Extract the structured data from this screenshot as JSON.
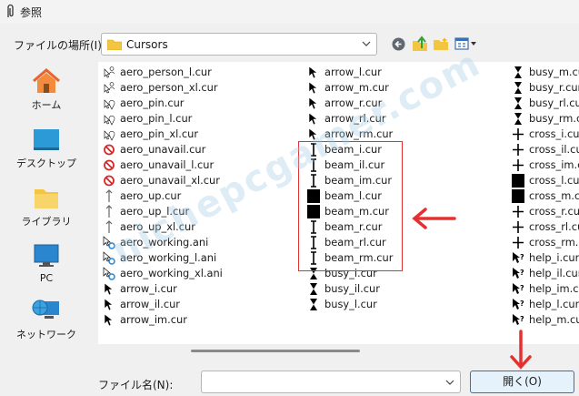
{
  "window": {
    "title": "参照"
  },
  "lookin": {
    "label": "ファイルの場所(I):",
    "value": "Cursors"
  },
  "places": [
    {
      "label": "ホーム",
      "icon": "home-icon"
    },
    {
      "label": "デスクトップ",
      "icon": "desktop-icon"
    },
    {
      "label": "ライブラリ",
      "icon": "library-icon"
    },
    {
      "label": "PC",
      "icon": "pc-icon"
    },
    {
      "label": "ネットワーク",
      "icon": "network-icon"
    }
  ],
  "files": {
    "col1": [
      {
        "name": "aero_person_l.cur",
        "icon": "person-cursor-icon"
      },
      {
        "name": "aero_person_xl.cur",
        "icon": "person-cursor-icon"
      },
      {
        "name": "aero_pin.cur",
        "icon": "pin-cursor-icon"
      },
      {
        "name": "aero_pin_l.cur",
        "icon": "pin-cursor-icon"
      },
      {
        "name": "aero_pin_xl.cur",
        "icon": "pin-cursor-icon"
      },
      {
        "name": "aero_unavail.cur",
        "icon": "unavailable-cursor-icon"
      },
      {
        "name": "aero_unavail_l.cur",
        "icon": "unavailable-cursor-icon"
      },
      {
        "name": "aero_unavail_xl.cur",
        "icon": "unavailable-cursor-icon"
      },
      {
        "name": "aero_up.cur",
        "icon": "up-arrow-cursor-icon"
      },
      {
        "name": "aero_up_l.cur",
        "icon": "up-arrow-cursor-icon"
      },
      {
        "name": "aero_up_xl.cur",
        "icon": "up-arrow-cursor-icon"
      },
      {
        "name": "aero_working.ani",
        "icon": "working-cursor-icon"
      },
      {
        "name": "aero_working_l.ani",
        "icon": "working-cursor-icon"
      },
      {
        "name": "aero_working_xl.ani",
        "icon": "working-cursor-icon"
      },
      {
        "name": "arrow_i.cur",
        "icon": "arrow-cursor-icon"
      },
      {
        "name": "arrow_il.cur",
        "icon": "arrow-cursor-icon"
      },
      {
        "name": "arrow_im.cur",
        "icon": "arrow-cursor-icon"
      }
    ],
    "col2": [
      {
        "name": "arrow_l.cur",
        "icon": "arrow-cursor-icon"
      },
      {
        "name": "arrow_m.cur",
        "icon": "arrow-cursor-icon"
      },
      {
        "name": "arrow_r.cur",
        "icon": "arrow-cursor-icon"
      },
      {
        "name": "arrow_rl.cur",
        "icon": "arrow-cursor-icon"
      },
      {
        "name": "arrow_rm.cur",
        "icon": "arrow-cursor-icon"
      },
      {
        "name": "beam_i.cur",
        "icon": "beam-cursor-icon"
      },
      {
        "name": "beam_il.cur",
        "icon": "beam-cursor-icon"
      },
      {
        "name": "beam_im.cur",
        "icon": "beam-cursor-icon"
      },
      {
        "name": "beam_l.cur",
        "icon": "block-cursor-icon"
      },
      {
        "name": "beam_m.cur",
        "icon": "block-cursor-icon"
      },
      {
        "name": "beam_r.cur",
        "icon": "beam-cursor-icon"
      },
      {
        "name": "beam_rl.cur",
        "icon": "beam-cursor-icon"
      },
      {
        "name": "beam_rm.cur",
        "icon": "beam-cursor-icon"
      },
      {
        "name": "busy_i.cur",
        "icon": "hourglass-cursor-icon"
      },
      {
        "name": "busy_il.cur",
        "icon": "hourglass-cursor-icon"
      },
      {
        "name": "busy_l.cur",
        "icon": "hourglass-cursor-icon"
      }
    ],
    "col3": [
      {
        "name": "busy_m.cur",
        "icon": "hourglass-cursor-icon"
      },
      {
        "name": "busy_r.cur",
        "icon": "hourglass-cursor-icon"
      },
      {
        "name": "busy_rl.cur",
        "icon": "hourglass-cursor-icon"
      },
      {
        "name": "busy_rm.cur",
        "icon": "hourglass-cursor-icon"
      },
      {
        "name": "cross_i.cur",
        "icon": "cross-cursor-icon"
      },
      {
        "name": "cross_il.cur",
        "icon": "cross-cursor-icon"
      },
      {
        "name": "cross_im.cur",
        "icon": "cross-cursor-icon"
      },
      {
        "name": "cross_l.cur",
        "icon": "block-cursor-icon"
      },
      {
        "name": "cross_m.cur",
        "icon": "block-cursor-icon"
      },
      {
        "name": "cross_r.cur",
        "icon": "cross-cursor-icon"
      },
      {
        "name": "cross_rl.cur",
        "icon": "cross-cursor-icon"
      },
      {
        "name": "cross_rm.cur",
        "icon": "cross-cursor-icon"
      },
      {
        "name": "help_i.cur",
        "icon": "help-cursor-icon"
      },
      {
        "name": "help_il.cur",
        "icon": "help-cursor-icon"
      },
      {
        "name": "help_im.cur",
        "icon": "help-cursor-icon"
      },
      {
        "name": "help_l.cur",
        "icon": "help-cursor-icon"
      },
      {
        "name": "help_m.cur",
        "icon": "help-cursor-icon"
      }
    ]
  },
  "filename": {
    "label": "ファイル名(N):",
    "value": ""
  },
  "open_button": {
    "label": "開く(O)"
  },
  "watermark": {
    "text": "nichepcgamer.com"
  },
  "colors": {
    "annotation": "#e53030",
    "accent": "#2a73c5",
    "folder": "#f4c542"
  }
}
